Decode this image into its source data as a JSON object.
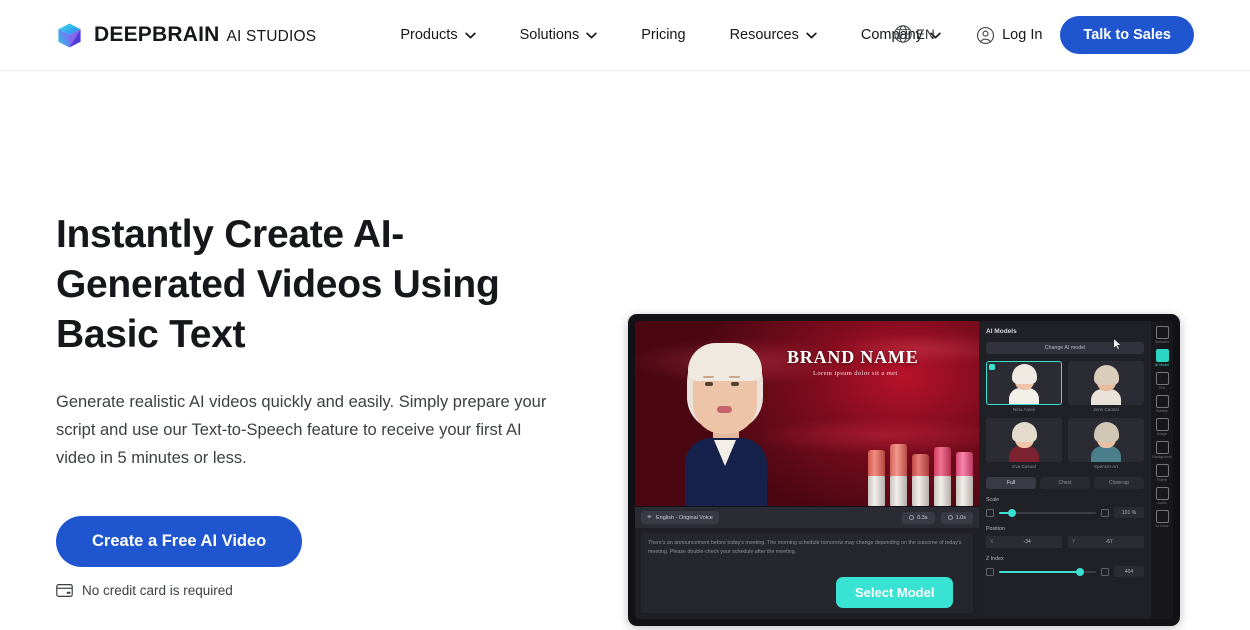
{
  "brand": {
    "logo_icon": "cube-logo-icon",
    "name": "DEEPBRAIN",
    "subtitle": "AI STUDIOS"
  },
  "nav": {
    "items": [
      {
        "label": "Products",
        "has_chevron": true,
        "icon": "chevron-down-icon"
      },
      {
        "label": "Solutions",
        "has_chevron": true,
        "icon": "chevron-down-icon"
      },
      {
        "label": "Pricing",
        "has_chevron": false,
        "icon": ""
      },
      {
        "label": "Resources",
        "has_chevron": true,
        "icon": "chevron-down-icon"
      },
      {
        "label": "Company",
        "has_chevron": true,
        "icon": "chevron-down-icon"
      }
    ]
  },
  "header_right": {
    "language": {
      "icon": "globe-icon",
      "label": "EN"
    },
    "login": {
      "icon": "user-circle-icon",
      "label": "Log In"
    },
    "cta": {
      "label": "Talk to Sales"
    }
  },
  "hero": {
    "title": "Instantly Create AI-Generated Videos Using Basic Text",
    "subtitle": "Generate realistic AI videos quickly and easily. Simply prepare your script and use our Text-to-Speech feature to receive your first AI video in 5 minutes or less.",
    "cta_label": "Create a Free AI Video",
    "note": {
      "icon": "credit-card-icon",
      "label": "No credit card is required"
    }
  },
  "app_mock": {
    "stage": {
      "brand_name": "BRAND NAME",
      "brand_tagline": "Lorem ipsum dolor sit a met"
    },
    "script_bar": {
      "voice_chip": {
        "icon": "voice-icon",
        "label": "English - Original Voice"
      },
      "duration_chip": {
        "icon": "clock-icon",
        "label": "0.3s"
      },
      "total_chip": {
        "icon": "clock-icon",
        "label": "1.0s"
      }
    },
    "script_text": "There's an announcement before today's meeting. The morning schedule tomorrow may change depending on the outcome of today's meeting. Please double-check your schedule after the meeting.",
    "select_model_button": "Select Model",
    "props": {
      "title": "AI Models",
      "change_button": "Change AI model",
      "models": [
        {
          "name": "Nina Ameli",
          "selected": true
        },
        {
          "name": "Jenn Causal",
          "selected": false
        },
        {
          "name": "Eva Casual",
          "selected": false
        },
        {
          "name": "Spencer Art",
          "selected": false
        }
      ],
      "tabs": [
        {
          "label": "Full",
          "active": true
        },
        {
          "label": "Chest",
          "active": false
        },
        {
          "label": "Close-up",
          "active": false
        }
      ],
      "scale": {
        "label": "Scale",
        "value": "101 %",
        "fill_pct": 13
      },
      "position": {
        "label": "Position",
        "x_key": "X",
        "x_value": "-34",
        "y_key": "Y",
        "y_value": "-67"
      },
      "zindex": {
        "label": "Z Index",
        "value": "404",
        "fill_pct": 84
      }
    },
    "rail": [
      {
        "label": "Scenario",
        "icon": "scenario-icon",
        "active": false
      },
      {
        "label": "AI Model",
        "icon": "ai-model-icon",
        "active": true
      },
      {
        "label": "Text",
        "icon": "text-icon",
        "active": false
      },
      {
        "label": "Subtitle",
        "icon": "subtitle-icon",
        "active": false
      },
      {
        "label": "Image",
        "icon": "image-icon",
        "active": false
      },
      {
        "label": "Background",
        "icon": "background-icon",
        "active": false
      },
      {
        "label": "Frame",
        "icon": "frame-icon",
        "active": false
      },
      {
        "label": "Audio",
        "icon": "audio-icon",
        "active": false
      },
      {
        "label": "AI Voice",
        "icon": "ai-voice-icon",
        "active": false
      }
    ],
    "cursor_icon": "mouse-cursor-icon"
  },
  "colors": {
    "brand_blue": "#1f56cf",
    "accent_teal": "#38e3d4",
    "text_dark": "#15171a",
    "text_body": "#3d4043",
    "app_bg": "#1b1b20"
  }
}
